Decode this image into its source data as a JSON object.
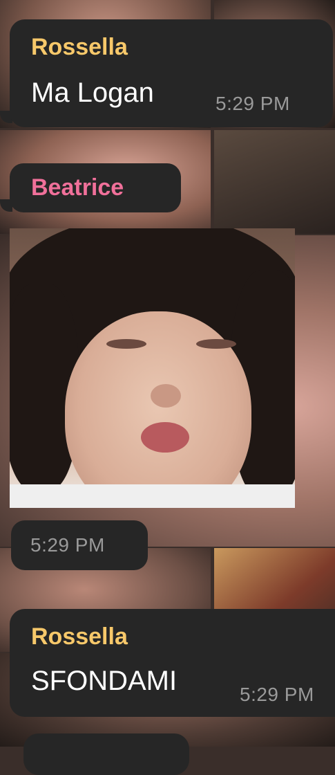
{
  "messages": [
    {
      "sender": "Rossella",
      "sender_color": "#f7c86a",
      "text": "Ma Logan",
      "time": "5:29 PM"
    },
    {
      "sender": "Beatrice",
      "sender_color": "#f0709a",
      "attachment": "photo",
      "time": "5:29 PM"
    },
    {
      "sender": "Rossella",
      "sender_color": "#f7c86a",
      "text": "SFONDAMI",
      "time": "5:29 PM"
    }
  ],
  "colors": {
    "bubble": "#262626",
    "time_text": "#9a9a9a",
    "message_text": "#ffffff"
  }
}
